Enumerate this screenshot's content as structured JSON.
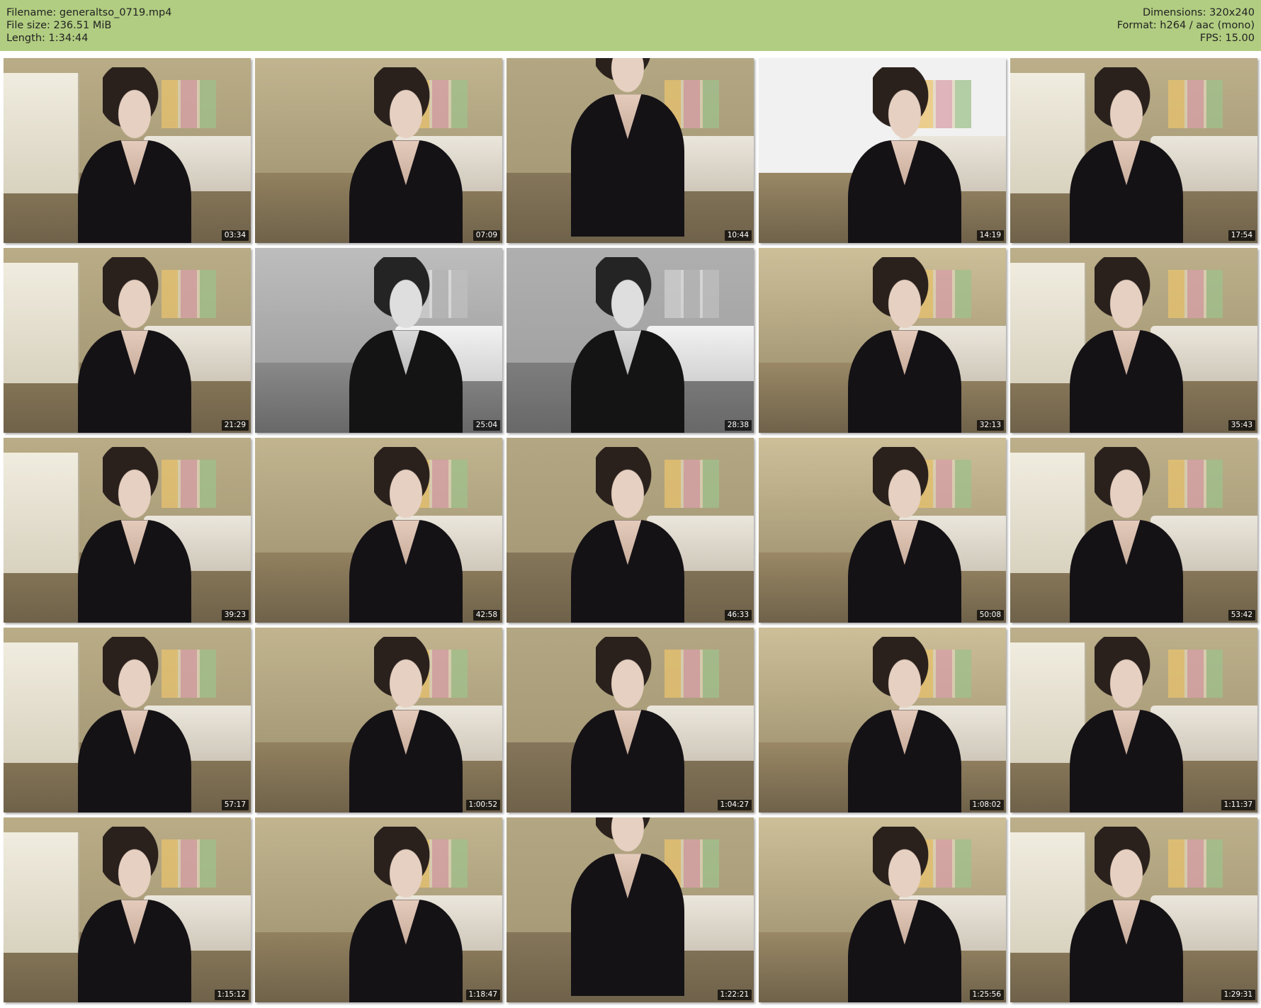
{
  "header": {
    "filename_label": "Filename:",
    "filename_value": "generaltso_0719.mp4",
    "filesize_label": "File size:",
    "filesize_value": "236.51 MiB",
    "length_label": "Length:",
    "length_value": "1:34:44",
    "dimensions_label": "Dimensions:",
    "dimensions_value": "320x240",
    "format_label": "Format:",
    "format_value": "h264 / aac (mono)",
    "fps_label": "FPS:",
    "fps_value": "15.00"
  },
  "colors": {
    "header_bg": "#b1cd81",
    "page_bg": "#ffffff",
    "timestamp_bg": "#000000",
    "timestamp_text": "#ffffff",
    "watermark": "#d06b6b"
  },
  "thumbnails": [
    {
      "time": "03:34"
    },
    {
      "time": "07:09"
    },
    {
      "time": "10:44"
    },
    {
      "time": "14:19"
    },
    {
      "time": "17:54"
    },
    {
      "time": "21:29"
    },
    {
      "time": "25:04"
    },
    {
      "time": "28:38"
    },
    {
      "time": "32:13"
    },
    {
      "time": "35:43"
    },
    {
      "time": "39:23"
    },
    {
      "time": "42:58"
    },
    {
      "time": "46:33"
    },
    {
      "time": "50:08"
    },
    {
      "time": "53:42"
    },
    {
      "time": "57:17"
    },
    {
      "time": "1:00:52"
    },
    {
      "time": "1:04:27"
    },
    {
      "time": "1:08:02"
    },
    {
      "time": "1:11:37"
    },
    {
      "time": "1:15:12"
    },
    {
      "time": "1:18:47"
    },
    {
      "time": "1:22:21"
    },
    {
      "time": "1:25:56"
    },
    {
      "time": "1:29:31"
    }
  ]
}
